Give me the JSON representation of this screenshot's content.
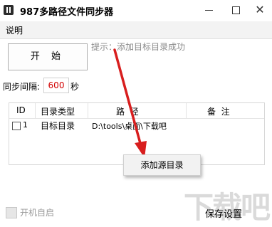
{
  "window": {
    "title": "987多路径文件同步器",
    "icons": [
      "app-icon",
      "minimize-icon",
      "maximize-icon",
      "close-icon"
    ]
  },
  "menubar": {
    "help_label": "说明"
  },
  "controls": {
    "start_label": "开 始",
    "hint_text": "提示：添加目标目录成功",
    "interval_label": "同步间隔:",
    "interval_value": "600",
    "interval_unit": "秒"
  },
  "table": {
    "columns": [
      "ID",
      "目录类型",
      "路  径",
      "备  注"
    ],
    "rows": [
      {
        "checked": false,
        "id": "1",
        "type": "目标目录",
        "path": "D:\\tools\\桌面\\下载吧",
        "note": ""
      }
    ]
  },
  "context_menu": {
    "item_label": "添加源目录"
  },
  "footer": {
    "autostart_label": "开机自启",
    "autostart_checked": false,
    "save_label": "保存设置"
  },
  "watermark": {
    "text": "下载吧"
  },
  "colors": {
    "interval_value": "#d20000",
    "arrow": "#d81e1e",
    "hint": "#8a8a8a"
  }
}
